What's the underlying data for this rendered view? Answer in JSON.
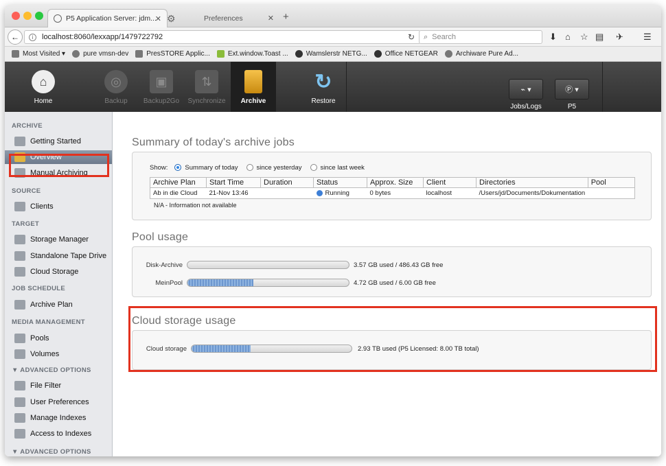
{
  "browser": {
    "active_tab_title": "P5 Application Server: jdm...",
    "inactive_tab_title": "Preferences",
    "url": "localhost:8060/lexxapp/1479722792",
    "search_placeholder": "Search",
    "bookmarks": [
      "Most Visited ▾",
      "pure vmsn-dev",
      "PresSTORE Applic...",
      "Ext.window.Toast ...",
      "Wamslerstr NETG...",
      "Office NETGEAR",
      "Archiware Pure Ad..."
    ]
  },
  "toolbar": {
    "items": [
      {
        "label": "Home",
        "icon": "home-icon"
      },
      {
        "label": "Backup",
        "icon": "backup-icon"
      },
      {
        "label": "Backup2Go",
        "icon": "backup2go-icon"
      },
      {
        "label": "Synchronize",
        "icon": "synchronize-icon"
      },
      {
        "label": "Archive",
        "icon": "archive-icon"
      },
      {
        "label": "Restore",
        "icon": "restore-icon"
      }
    ],
    "jobs_logs_label": "Jobs/Logs",
    "p5_label": "P5"
  },
  "sidebar": {
    "sections": {
      "archive": "ARCHIVE",
      "source": "SOURCE",
      "target": "TARGET",
      "job_schedule": "JOB SCHEDULE",
      "media": "MEDIA MANAGEMENT",
      "advanced1": "▼ ADVANCED OPTIONS",
      "advanced2": "▼ ADVANCED OPTIONS"
    },
    "items": {
      "getting_started": "Getting Started",
      "overview": "Overview",
      "manual_archiving": "Manual Archiving",
      "clients": "Clients",
      "storage_manager": "Storage Manager",
      "standalone_tape": "Standalone Tape Drive",
      "cloud_storage": "Cloud Storage",
      "archive_plan": "Archive Plan",
      "pools": "Pools",
      "volumes": "Volumes",
      "file_filter": "File Filter",
      "user_prefs": "User Preferences",
      "manage_indexes": "Manage Indexes",
      "access_indexes": "Access to Indexes"
    }
  },
  "summary": {
    "title": "Summary of today's archive jobs",
    "show_label": "Show:",
    "options": [
      "Summary of today",
      "since yesterday",
      "since last week"
    ],
    "selected_option": "Summary of today",
    "columns": [
      "Archive Plan",
      "Start Time",
      "Duration",
      "Status",
      "Approx. Size",
      "Client",
      "Directories",
      "Pool"
    ],
    "rows": [
      {
        "plan": "Ab in die Cloud",
        "start": "21-Nov 13:46",
        "duration": "",
        "status": "Running",
        "size": "0 bytes",
        "client": "localhost",
        "directories": "/Users/jd/Documents/Dokumentation",
        "pool": ""
      }
    ],
    "footnote": "N/A - Information not available"
  },
  "pool_usage": {
    "title": "Pool usage",
    "pools": [
      {
        "name": "Disk-Archive",
        "used_fraction": 0.0,
        "text": "3.57 GB used / 486.43 GB free"
      },
      {
        "name": "MeinPool",
        "used_fraction": 0.41,
        "text": "4.72 GB used / 6.00 GB free"
      }
    ]
  },
  "cloud_usage": {
    "title": "Cloud storage usage",
    "label": "Cloud storage",
    "used_fraction": 0.37,
    "text": "2.93 TB used (P5 Licensed: 8.00 TB total)"
  },
  "colors": {
    "highlight": "#e2321f",
    "selected_item": "#7d8a9c",
    "toolbar_bg": "#3b3b3b"
  }
}
